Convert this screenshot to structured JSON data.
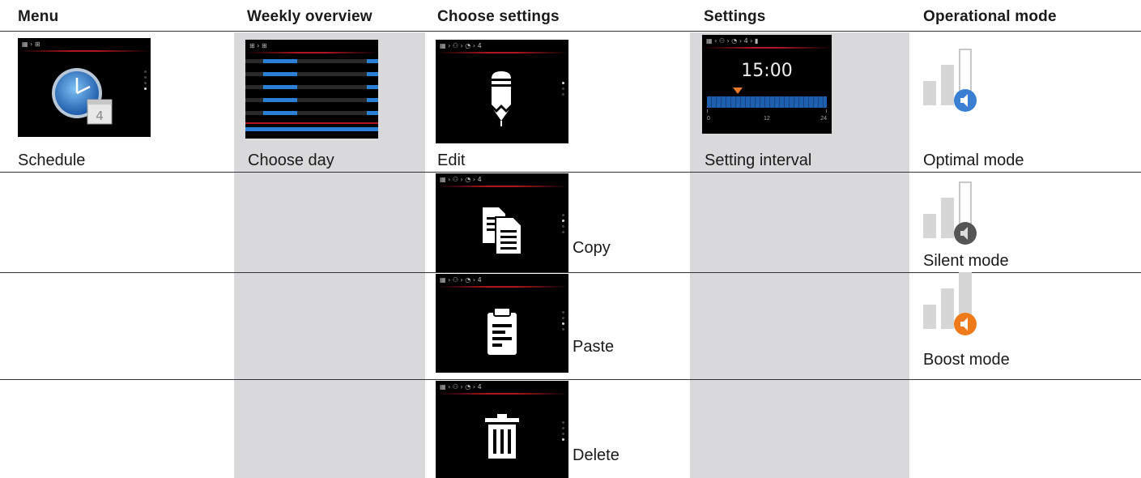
{
  "headers": [
    "Menu",
    "Weekly overview",
    "Choose settings",
    "Settings",
    "Operational mode"
  ],
  "menu": {
    "label": "Schedule",
    "screen_crumb": "▦ › ⊞",
    "icon": "clock-calendar-icon"
  },
  "weekly": {
    "label": "Choose day",
    "screen_crumb": "⊞ › ⊞"
  },
  "choose_settings": [
    {
      "label": "Edit",
      "crumb": "▦ › ⚇ › ◔ › 4",
      "icon": "pencil-icon"
    },
    {
      "label": "Copy",
      "crumb": "▦ › ⚇ › ◔ › 4",
      "icon": "copy-icon"
    },
    {
      "label": "Paste",
      "crumb": "▦ › ⚇ › ◔ › 4",
      "icon": "clipboard-icon"
    },
    {
      "label": "Delete",
      "crumb": "▦ › ⚇ › ◔ › 4",
      "icon": "trash-icon"
    }
  ],
  "settings": {
    "label": "Setting interval",
    "crumb": "▦ › ⚇ › ◔ › 4 › ▮",
    "time": "15:00",
    "ticks": [
      "0",
      "12",
      "24"
    ]
  },
  "modes": [
    {
      "label": "Optimal mode",
      "color": "#3a7fd4",
      "icon": "speaker-blue-icon"
    },
    {
      "label": "Silent mode",
      "color": "#555555",
      "icon": "speaker-gray-icon"
    },
    {
      "label": "Boost mode",
      "color": "#ee7a1a",
      "icon": "speaker-orange-icon"
    }
  ]
}
